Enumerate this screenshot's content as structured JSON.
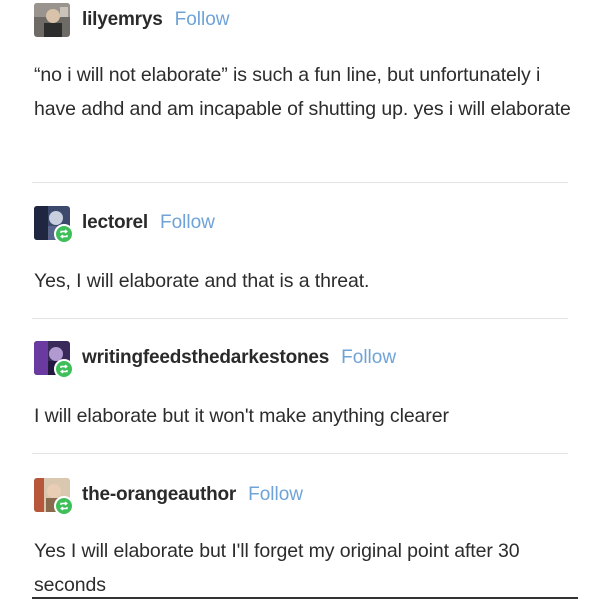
{
  "follow_label": "Follow",
  "colors": {
    "follow": "#6fa3d8",
    "reblog_badge": "#3fbf5a",
    "text": "#2c2c2c"
  },
  "posts": [
    {
      "username": "lilyemrys",
      "text": "“no i will not elaborate” is such a fun line, but unfortunately i have adhd and am incapable of shutting up. yes i will elaborate",
      "avatar_icon": "avatar-photo",
      "reblog": false
    },
    {
      "username": "lectorel",
      "text": "Yes, I will elaborate and that is a threat.",
      "avatar_icon": "avatar-photo",
      "reblog": true
    },
    {
      "username": "writingfeedsthedarkestones",
      "text": "I will elaborate but it won't make anything clearer",
      "avatar_icon": "avatar-photo",
      "reblog": true
    },
    {
      "username": "the-orangeauthor",
      "text": "Yes I will elaborate but I'll forget my original point after 30 seconds",
      "avatar_icon": "avatar-photo",
      "reblog": true
    }
  ]
}
